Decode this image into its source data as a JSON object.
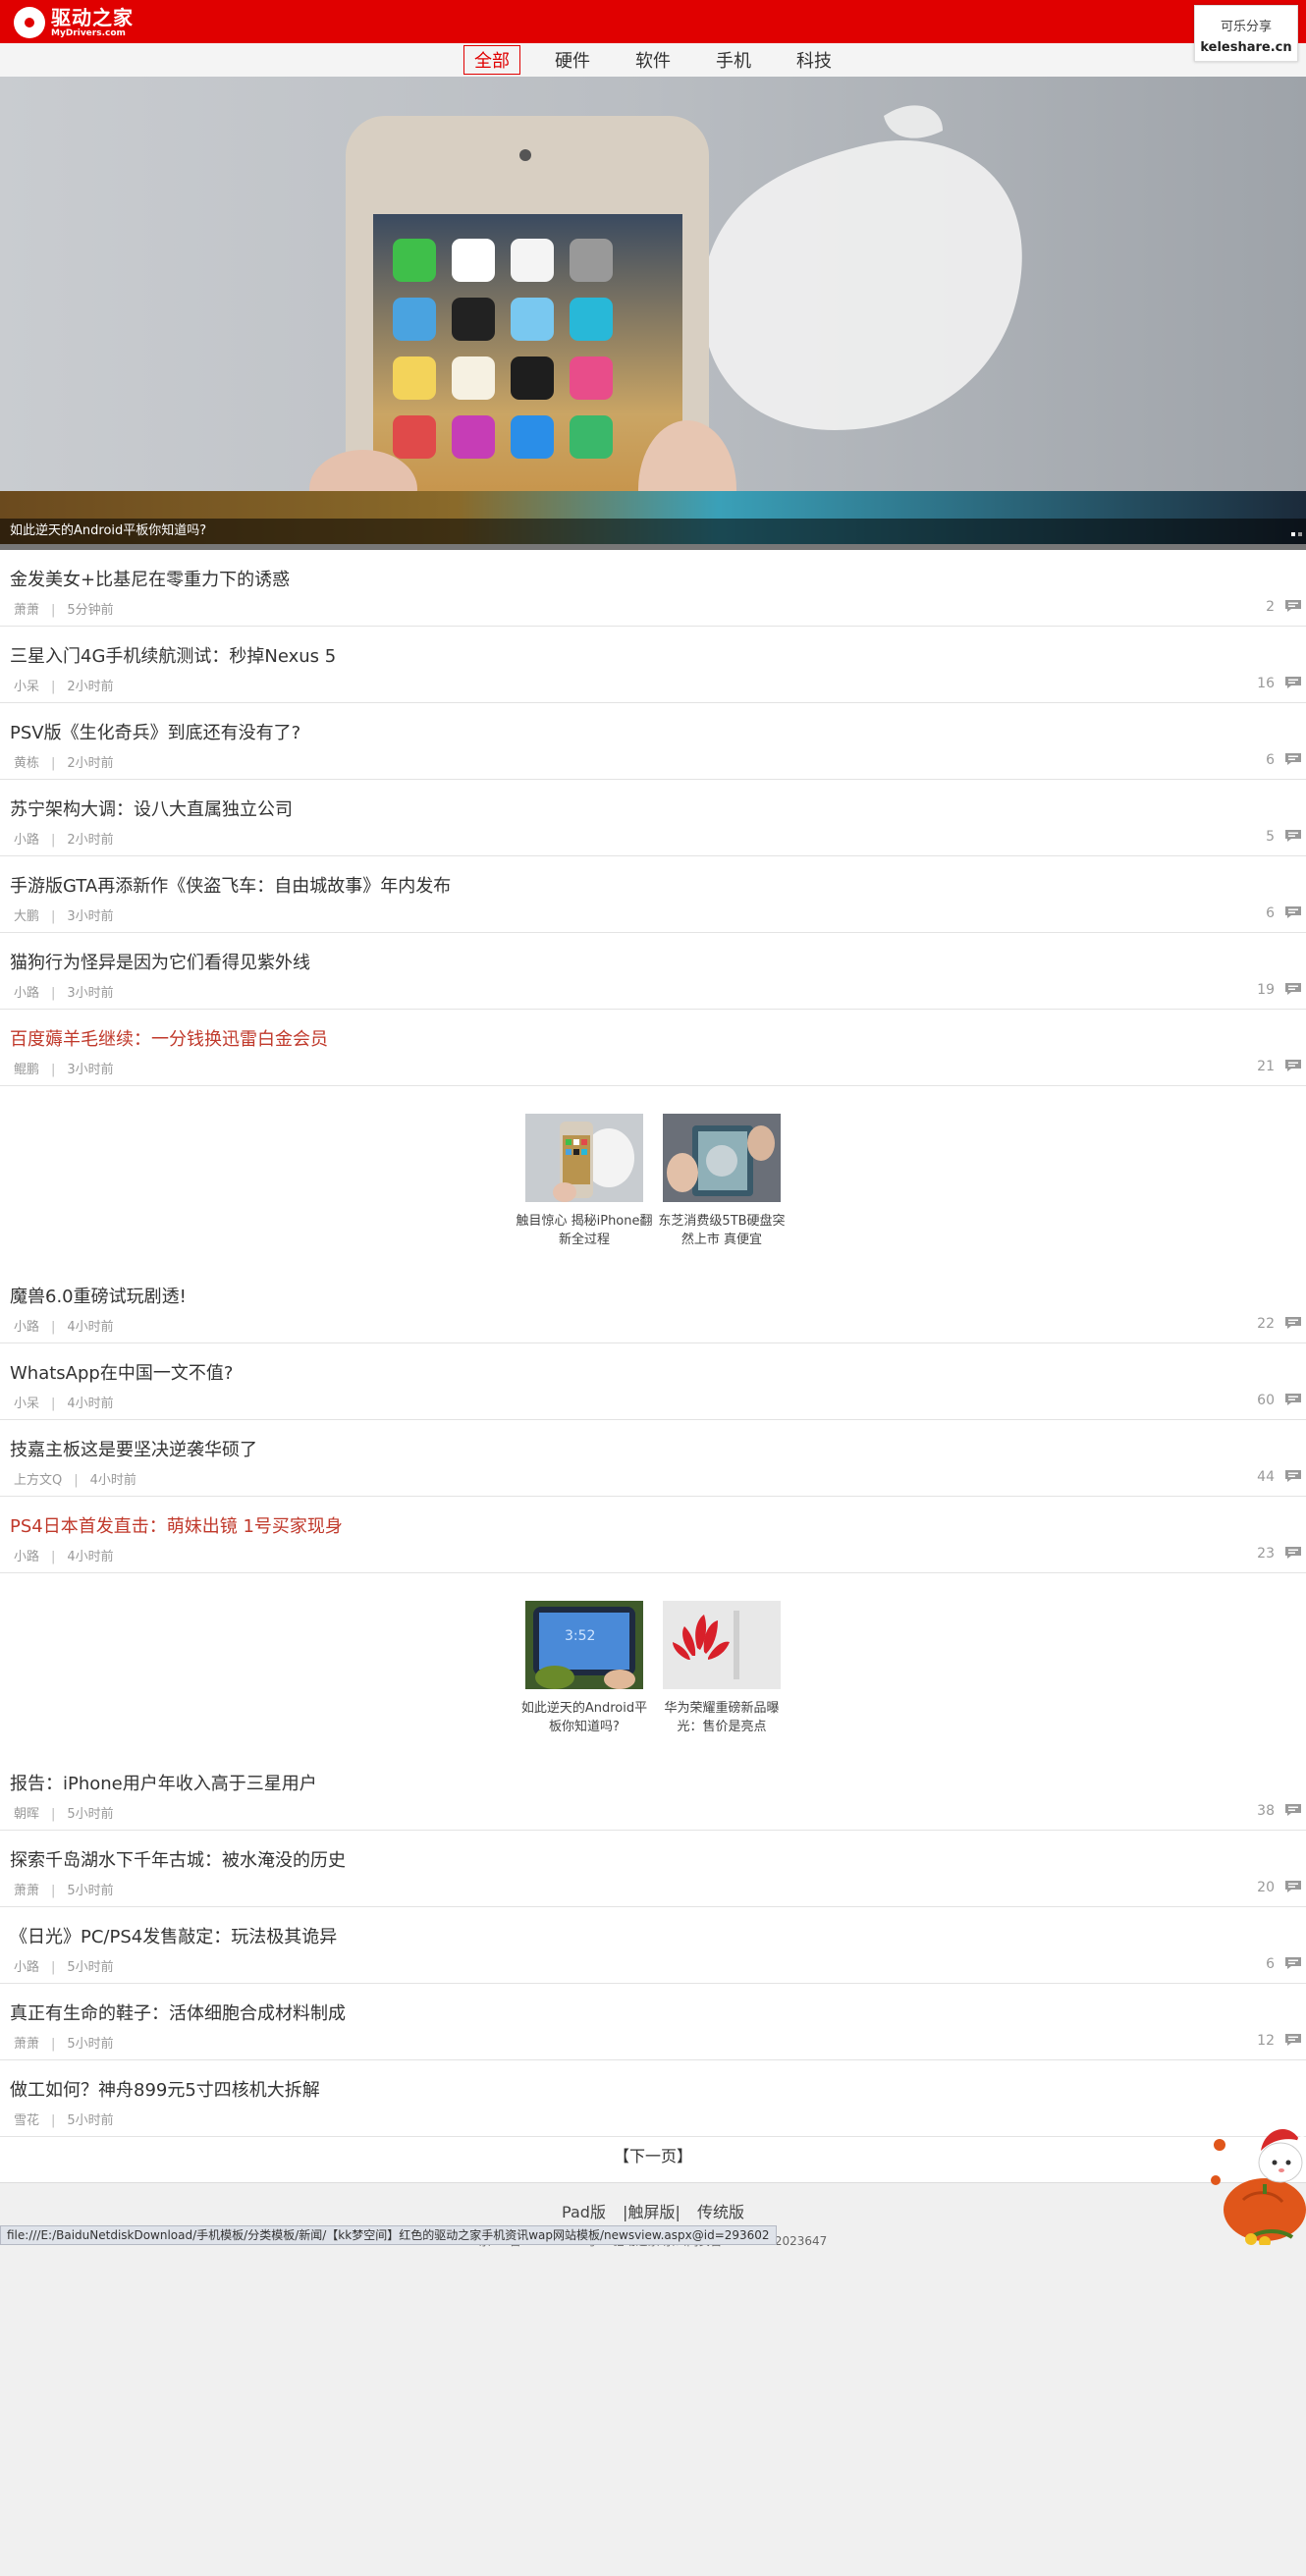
{
  "header": {
    "logo_cn": "驱动之家",
    "logo_en": "MyDrivers.com"
  },
  "share": {
    "line1": "可乐分享",
    "line2": "keleshare.cn"
  },
  "nav": [
    "全部",
    "硬件",
    "软件",
    "手机",
    "科技"
  ],
  "banner": {
    "caption": "如此逆天的Android平板你知道吗?"
  },
  "articles_a": [
    {
      "title": "金发美女+比基尼在零重力下的诱惑",
      "author": "萧萧",
      "time": "5分钟前",
      "comments": "2"
    },
    {
      "title": "三星入门4G手机续航测试：秒掉Nexus 5",
      "author": "小呆",
      "time": "2小时前",
      "comments": "16"
    },
    {
      "title": "PSV版《生化奇兵》到底还有没有了?",
      "author": "黄栋",
      "time": "2小时前",
      "comments": "6"
    },
    {
      "title": "苏宁架构大调：设八大直属独立公司",
      "author": "小路",
      "time": "2小时前",
      "comments": "5"
    },
    {
      "title": "手游版GTA再添新作《侠盗飞车：自由城故事》年内发布",
      "author": "大鹏",
      "time": "3小时前",
      "comments": "6"
    },
    {
      "title": "猫狗行为怪异是因为它们看得见紫外线",
      "author": "小路",
      "time": "3小时前",
      "comments": "19"
    },
    {
      "title": "百度薅羊毛继续：一分钱换迅雷白金会员",
      "author": "鲲鹏",
      "time": "3小时前",
      "comments": "21",
      "hot": true
    }
  ],
  "pics_a": [
    {
      "caption": "触目惊心 揭秘iPhone翻新全过程"
    },
    {
      "caption": "东芝消费级5TB硬盘突然上市 真便宜"
    }
  ],
  "articles_b": [
    {
      "title": "魔兽6.0重磅试玩剧透!",
      "author": "小路",
      "time": "4小时前",
      "comments": "22"
    },
    {
      "title": "WhatsApp在中国一文不值?",
      "author": "小呆",
      "time": "4小时前",
      "comments": "60"
    },
    {
      "title": "技嘉主板这是要坚决逆袭华硕了",
      "author": "上方文Q",
      "time": "4小时前",
      "comments": "44"
    },
    {
      "title": "PS4日本首发直击：萌妹出镜 1号买家现身",
      "author": "小路",
      "time": "4小时前",
      "comments": "23",
      "hot": true
    }
  ],
  "pics_b": [
    {
      "caption": "如此逆天的Android平板你知道吗?"
    },
    {
      "caption": "华为荣耀重磅新品曝光：售价是亮点"
    }
  ],
  "articles_c": [
    {
      "title": "报告：iPhone用户年收入高于三星用户",
      "author": "朝晖",
      "time": "5小时前",
      "comments": "38"
    },
    {
      "title": "探索千岛湖水下千年古城：被水淹没的历史",
      "author": "萧萧",
      "time": "5小时前",
      "comments": "20"
    },
    {
      "title": "《日光》PC/PS4发售敲定：玩法极其诡异",
      "author": "小路",
      "time": "5小时前",
      "comments": "6"
    },
    {
      "title": "真正有生命的鞋子：活体细胞合成材料制成",
      "author": "萧萧",
      "time": "5小时前",
      "comments": "12"
    },
    {
      "title": "做工如何？神舟899元5寸四核机大拆解",
      "author": "雪花",
      "time": "5小时前",
      "comments": ""
    }
  ],
  "next_page": "【下一页】",
  "footer": {
    "links": [
      "Pad版",
      "|触屏版|",
      "传统版"
    ],
    "icp": "京ICP备 11024344号-7   驱动之家 京公网安备11010502023647"
  },
  "statusbar": "file:///E:/BaiduNetdiskDownload/手机模板/分类模板/新闻/【kk梦空间】红色的驱动之家手机资讯wap网站模板/newsview.aspx@id=293602"
}
